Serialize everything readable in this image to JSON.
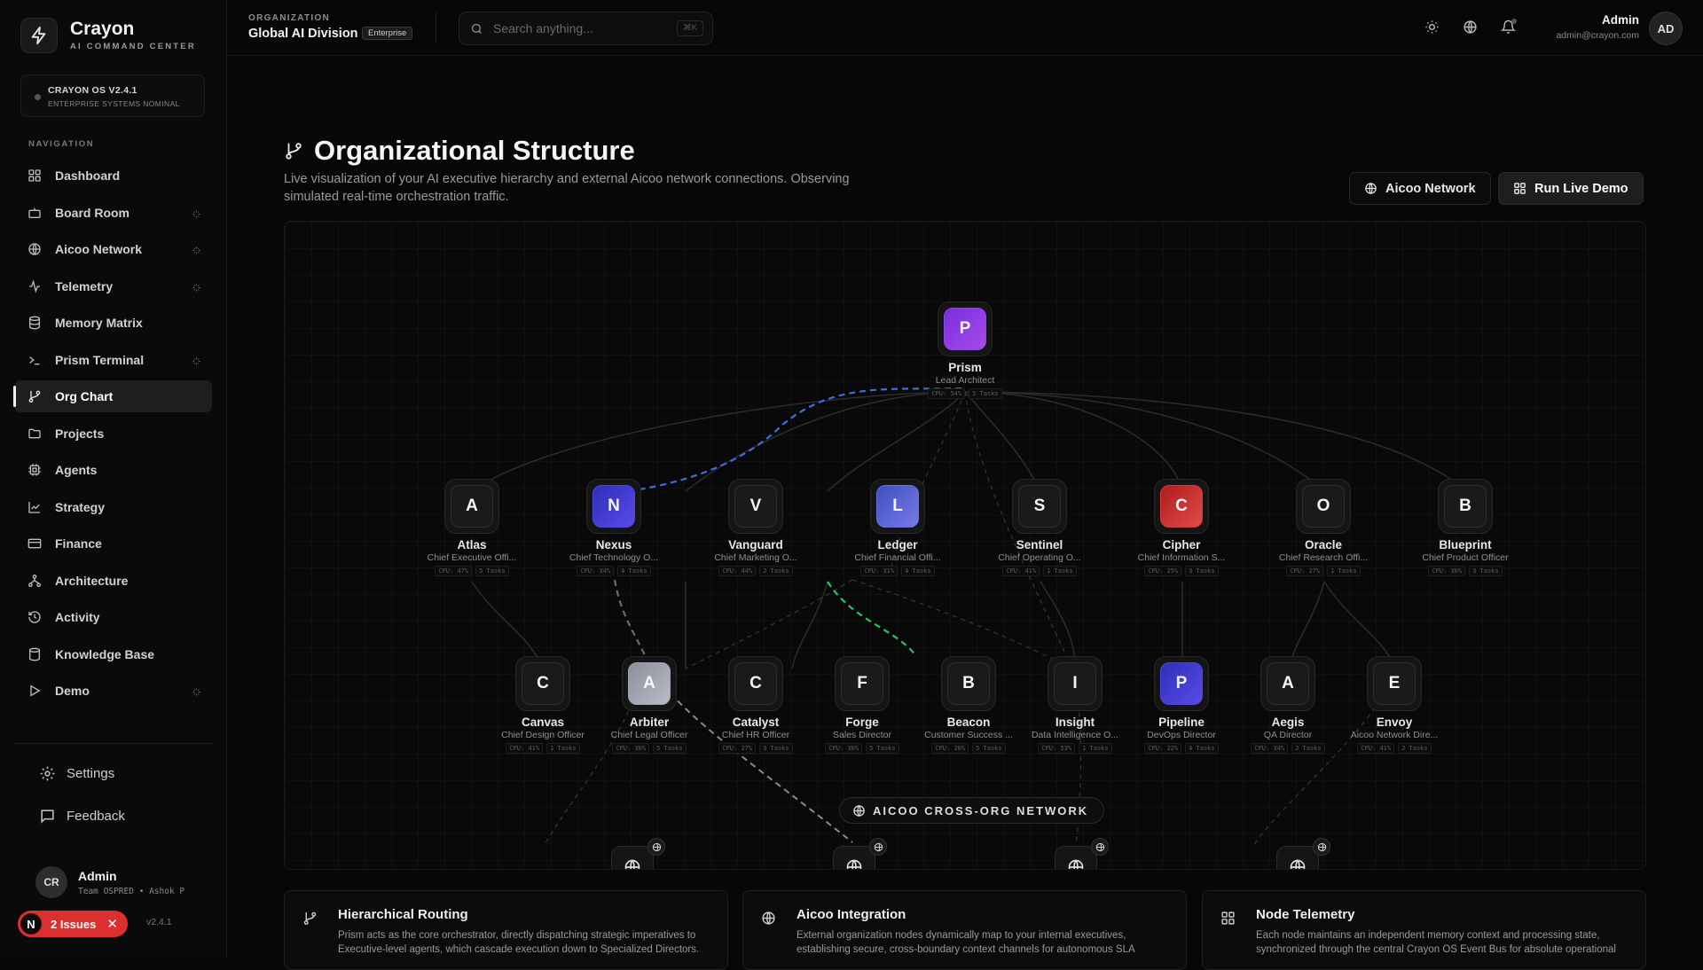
{
  "brand": {
    "name": "Crayon",
    "subtitle": "AI COMMAND CENTER"
  },
  "os_status": {
    "title": "CRAYON OS V2.4.1",
    "subtitle": "ENTERPRISE SYSTEMS NOMINAL"
  },
  "nav": {
    "heading": "NAVIGATION",
    "items": [
      {
        "label": "Dashboard",
        "icon": "grid-icon"
      },
      {
        "label": "Board Room",
        "icon": "bot-icon"
      },
      {
        "label": "Aicoo Network",
        "icon": "globe-icon"
      },
      {
        "label": "Telemetry",
        "icon": "activity-icon"
      },
      {
        "label": "Memory Matrix",
        "icon": "database-icon"
      },
      {
        "label": "Prism Terminal",
        "icon": "terminal-icon"
      },
      {
        "label": "Org Chart",
        "icon": "git-branch-icon"
      },
      {
        "label": "Projects",
        "icon": "folder-icon"
      },
      {
        "label": "Agents",
        "icon": "cpu-icon"
      },
      {
        "label": "Strategy",
        "icon": "trend-icon"
      },
      {
        "label": "Finance",
        "icon": "card-icon"
      },
      {
        "label": "Architecture",
        "icon": "network-icon"
      },
      {
        "label": "Activity",
        "icon": "history-icon"
      },
      {
        "label": "Knowledge Base",
        "icon": "book-icon"
      },
      {
        "label": "Demo",
        "icon": "play-icon"
      }
    ]
  },
  "footer_links": {
    "settings": "Settings",
    "feedback": "Feedback"
  },
  "user": {
    "initials": "CR",
    "name": "Admin",
    "team": "Team OSPRED • Ashok P"
  },
  "issues": {
    "icon_letter": "N",
    "label": "2 Issues"
  },
  "version": "v2.4.1",
  "topbar": {
    "org_label": "ORGANIZATION",
    "org_name": "Global AI Division",
    "org_badge": "Enterprise",
    "search_placeholder": "Search anything...",
    "search_shortcut": "⌘K",
    "admin_name": "Admin",
    "admin_email": "admin@crayon.com",
    "admin_initials": "AD"
  },
  "page": {
    "title": "Organizational Structure",
    "description": "Live visualization of your AI executive hierarchy and external Aicoo network connections. Observing simulated real-time orchestration traffic.",
    "btn_network": "Aicoo Network",
    "btn_demo": "Run Live Demo"
  },
  "org": {
    "root": {
      "letter": "P",
      "name": "Prism",
      "role": "Lead Architect",
      "cpu": "CPU: 54%",
      "tasks": "5 Tasks"
    },
    "executives": [
      {
        "letter": "A",
        "name": "Atlas",
        "role": "Chief Executive Offi...",
        "cpu": "CPU: 47%",
        "tasks": "5 Tasks"
      },
      {
        "letter": "N",
        "name": "Nexus",
        "role": "Chief Technology O...",
        "cpu": "CPU: 34%",
        "tasks": "4 Tasks"
      },
      {
        "letter": "V",
        "name": "Vanguard",
        "role": "Chief Marketing O...",
        "cpu": "CPU: 44%",
        "tasks": "2 Tasks"
      },
      {
        "letter": "L",
        "name": "Ledger",
        "role": "Chief Financial Offi...",
        "cpu": "CPU: 31%",
        "tasks": "4 Tasks"
      },
      {
        "letter": "S",
        "name": "Sentinel",
        "role": "Chief Operating O...",
        "cpu": "CPU: 41%",
        "tasks": "1 Tasks"
      },
      {
        "letter": "C",
        "name": "Cipher",
        "role": "Chief Information S...",
        "cpu": "CPU: 25%",
        "tasks": "3 Tasks"
      },
      {
        "letter": "O",
        "name": "Oracle",
        "role": "Chief Research Offi...",
        "cpu": "CPU: 27%",
        "tasks": "1 Tasks"
      },
      {
        "letter": "B",
        "name": "Blueprint",
        "role": "Chief Product Officer",
        "cpu": "CPU: 30%",
        "tasks": "3 Tasks"
      }
    ],
    "directors": [
      {
        "letter": "C",
        "name": "Canvas",
        "role": "Chief Design Officer",
        "cpu": "CPU: 41%",
        "tasks": "1 Tasks"
      },
      {
        "letter": "A",
        "name": "Arbiter",
        "role": "Chief Legal Officer",
        "cpu": "CPU: 30%",
        "tasks": "5 Tasks"
      },
      {
        "letter": "C",
        "name": "Catalyst",
        "role": "Chief HR Officer",
        "cpu": "CPU: 27%",
        "tasks": "3 Tasks"
      },
      {
        "letter": "F",
        "name": "Forge",
        "role": "Sales Director",
        "cpu": "CPU: 30%",
        "tasks": "5 Tasks"
      },
      {
        "letter": "B",
        "name": "Beacon",
        "role": "Customer Success ...",
        "cpu": "CPU: 20%",
        "tasks": "5 Tasks"
      },
      {
        "letter": "I",
        "name": "Insight",
        "role": "Data Intelligence O...",
        "cpu": "CPU: 53%",
        "tasks": "1 Tasks"
      },
      {
        "letter": "P",
        "name": "Pipeline",
        "role": "DevOps Director",
        "cpu": "CPU: 22%",
        "tasks": "4 Tasks"
      },
      {
        "letter": "A",
        "name": "Aegis",
        "role": "QA Director",
        "cpu": "CPU: 34%",
        "tasks": "2 Tasks"
      },
      {
        "letter": "E",
        "name": "Envoy",
        "role": "Aicoo Network Dire...",
        "cpu": "CPU: 41%",
        "tasks": "2 Tasks"
      }
    ],
    "network_label": "AICOO CROSS-ORG NETWORK"
  },
  "cards": [
    {
      "title": "Hierarchical Routing",
      "body": "Prism acts as the core orchestrator, directly dispatching strategic imperatives to Executive-level agents, which cascade execution down to Specialized Directors.",
      "icon": "git-branch-icon"
    },
    {
      "title": "Aicoo Integration",
      "body": "External organization nodes dynamically map to your internal executives, establishing secure, cross-boundary context channels for autonomous SLA",
      "icon": "globe-icon"
    },
    {
      "title": "Node Telemetry",
      "body": "Each node maintains an independent memory context and processing state, synchronized through the central Crayon OS Event Bus for absolute operational",
      "icon": "grid-icon"
    }
  ],
  "colors": {
    "accent_blue": "#3b6ee8",
    "accent_green": "#22c55e",
    "issues_red": "#dc2f2f"
  }
}
